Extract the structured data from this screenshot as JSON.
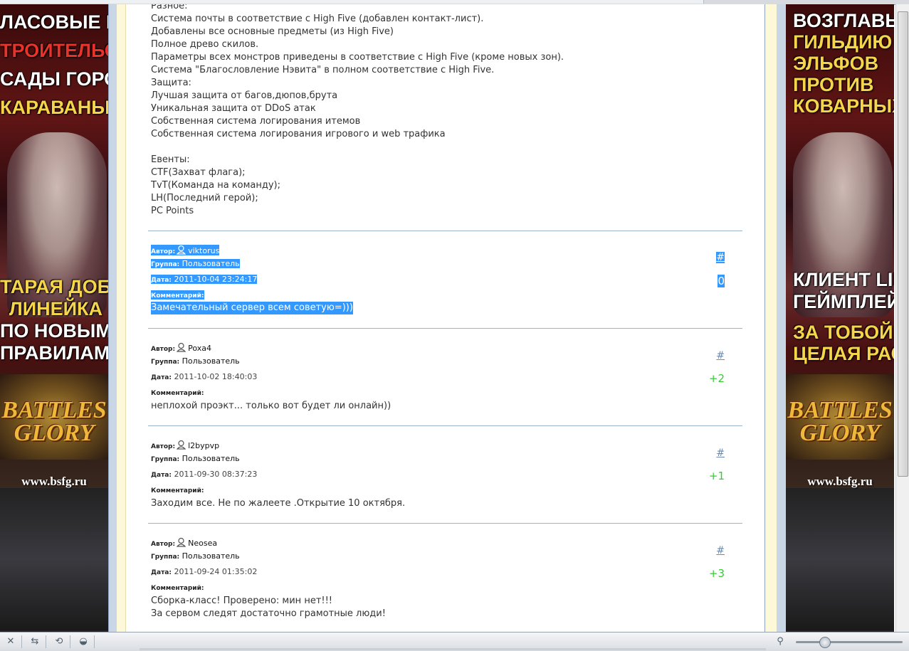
{
  "banner_left": {
    "lines": [
      {
        "text": "ЛАСОВЫЕ ВОЙНЫ",
        "color": "white"
      },
      {
        "text": "ТРОИТЕЛЬСТВО",
        "color": "red"
      },
      {
        "text": "САДЫ ГОРОДОВ",
        "color": "white"
      },
      {
        "text": "КАРАВАНЫ",
        "color": "yellow"
      }
    ],
    "lines2": [
      {
        "text": "ТАРАЯ ДОБРАЯ",
        "color": "yellow"
      },
      {
        "text": "ЛИНЕЙКА",
        "color": "yellow"
      },
      {
        "text": "ПО НОВЫМ",
        "color": "white"
      },
      {
        "text": "ПРАВИЛАМ",
        "color": "white"
      }
    ],
    "logo_top": "BATTLES",
    "logo_bottom": "GLORY",
    "site": "www.bsfg.ru"
  },
  "banner_right": {
    "lines": [
      {
        "text": "ВОЗГЛАВЬ",
        "color": "white"
      },
      {
        "text": "ГИЛЬДИЮ",
        "color": "yellow"
      },
      {
        "text": "ЭЛЬФОВ",
        "color": "yellow"
      },
      {
        "text": "ПРОТИВ",
        "color": "yellow"
      },
      {
        "text": "КОВАРНЫХ ОРК",
        "color": "yellow"
      }
    ],
    "lines2": [
      {
        "text": "КЛИЕНТ LINEAG",
        "color": "white"
      },
      {
        "text": "ГЕЙМПЛЕЙ НА",
        "color": "white"
      },
      {
        "text": "ЗА ТОБОЙ",
        "color": "yellow"
      },
      {
        "text": "ЦЕЛАЯ РАСА!",
        "color": "yellow"
      }
    ],
    "logo_top": "BATTLES",
    "logo_bottom": "GLORY",
    "site": "www.bsfg.ru"
  },
  "notes": [
    "Разное:",
    "Система почты в соответствие с High Five (добавлен контакт-лист).",
    "Добавлены все основные предметы (из High Five)",
    "Полное древо скилов.",
    "Параметры всех монстров приведены в соответствие с High Five (кроме новых зон).",
    "Система \"Благословление Нэвита\" в полном соответствие с High Five.",
    "Защита:",
    "Лучшая защита от багов,дюпов,брута",
    "Уникальная защита от DDoS атак",
    "Собственная система логирования итемов",
    "Собственная система логирования игрового и web трафика",
    "",
    "Евенты:",
    "CTF(Захват флага);",
    "TvT(Команда на команду);",
    "LH(Последний герой);",
    "PC Points"
  ],
  "labels": {
    "author": "Автор:",
    "group": "Группа:",
    "date": "Дата:",
    "comment": "Комментарий:",
    "hash": "#"
  },
  "comments": [
    {
      "author": "viktorus",
      "group": "Пользователь",
      "date": "2011-10-04 23:24:17",
      "rating": "0",
      "body": [
        "Замечательный сервер всем советую=)))"
      ],
      "selected": true
    },
    {
      "author": "Poxa4",
      "group": "Пользователь",
      "date": "2011-10-02 18:40:03",
      "rating": "+2",
      "body": [
        "неплохой проэкт... только вот будет ли онлайн))"
      ],
      "selected": false
    },
    {
      "author": "l2bypvp",
      "group": "Пользователь",
      "date": "2011-09-30 08:37:23",
      "rating": "+1",
      "body": [
        "Заходим все. Не по жалеете .Открытие 10 октября."
      ],
      "selected": false
    },
    {
      "author": "Neosea",
      "group": "Пользователь",
      "date": "2011-09-24 01:35:02",
      "rating": "+3",
      "body": [
        "Сборка-класс! Проверено: мин нет!!!",
        "За сервом следят достаточно грамотные люди!"
      ],
      "selected": false
    }
  ],
  "statusbar": {
    "icons": [
      "close-icon",
      "arrows-icon",
      "share-icon",
      "speedometer-icon"
    ],
    "zoom_icon": "magnifier-icon",
    "zoom_level": 0.27
  },
  "colors": {
    "selection": "#3399ff",
    "rating": "#33cc33",
    "link": "#6a8ab0",
    "divider": "#9db4c8"
  }
}
